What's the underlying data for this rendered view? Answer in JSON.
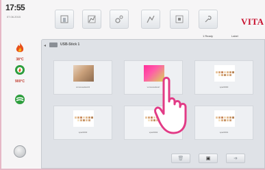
{
  "status_bar": {
    "time": "17:55",
    "date": "07.06.2015"
  },
  "sidebar": {
    "items": [
      {
        "icon": "flame-icon",
        "temp": "38°C",
        "color": "#e8501a"
      },
      {
        "icon": "furnace-icon",
        "temp": "900°C",
        "color": "#2e9e3e"
      },
      {
        "icon": "vacuum-icon",
        "temp": "",
        "color": "#2e9e3e"
      }
    ]
  },
  "toolbar": {
    "buttons": [
      {
        "name": "program-icon"
      },
      {
        "name": "firing-chart-icon"
      },
      {
        "name": "settings-icon"
      },
      {
        "name": "calibrate-icon"
      },
      {
        "name": "media-icon"
      },
      {
        "name": "service-icon"
      }
    ],
    "brand": "VITA"
  },
  "status": {
    "ready": "1 Ready",
    "label": "Label"
  },
  "browser": {
    "breadcrumb": "USB-Stick 1",
    "files": [
      {
        "label": "vumoveatwort2",
        "thumb": "photo"
      },
      {
        "label": "vumoveatwort",
        "thumb": "pink"
      },
      {
        "label": "vpar0000",
        "thumb": "swatch"
      },
      {
        "label": "vpar0003",
        "thumb": "swatch"
      },
      {
        "label": "vpar0002",
        "thumb": "swatch"
      },
      {
        "label": "vpar0001",
        "thumb": "swatch"
      }
    ]
  },
  "colors": {
    "accent": "#c8102e",
    "frame": "#e6b8c6",
    "panel": "#dfe2e7"
  }
}
